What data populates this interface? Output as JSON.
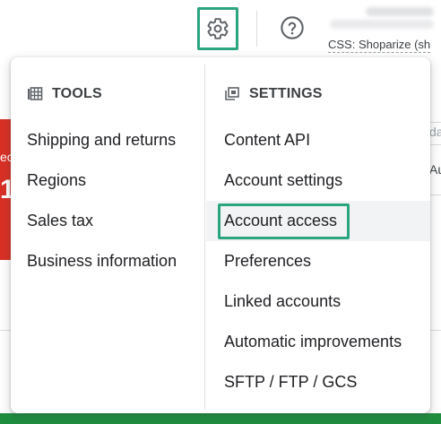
{
  "header": {
    "settings_icon": "gear-icon",
    "help_icon": "help-circle-icon",
    "account_label": "CSS: Shoparize (sh"
  },
  "background": {
    "left_text": "ec",
    "left_number": "1",
    "right_field_text": "da",
    "right_text": "Au"
  },
  "menu": {
    "tools": {
      "icon": "tools-grid-icon",
      "heading": "TOOLS",
      "items": [
        {
          "label": "Shipping and returns"
        },
        {
          "label": "Regions"
        },
        {
          "label": "Sales tax"
        },
        {
          "label": "Business information"
        }
      ]
    },
    "settings": {
      "icon": "settings-copy-icon",
      "heading": "SETTINGS",
      "items": [
        {
          "label": "Content API"
        },
        {
          "label": "Account settings"
        },
        {
          "label": "Account access"
        },
        {
          "label": "Preferences"
        },
        {
          "label": "Linked accounts"
        },
        {
          "label": "Automatic improvements"
        },
        {
          "label": "SFTP / FTP / GCS"
        }
      ]
    }
  },
  "colors": {
    "highlight_border": "#2aa57f",
    "alert_red": "#d93025",
    "brand_green": "#1e8e3e",
    "hover_bg": "#f1f3f4"
  }
}
